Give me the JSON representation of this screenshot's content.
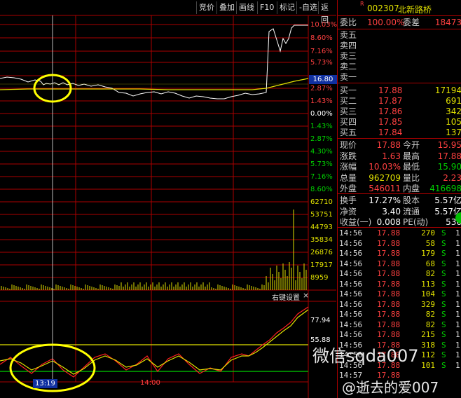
{
  "toolbar": {
    "buttons": [
      "竞价",
      "叠加",
      "画线",
      "F10",
      "标记",
      "-自选",
      "返回"
    ]
  },
  "price_axis": [
    "10.03%",
    "8.60%",
    "7.16%",
    "5.73%",
    "4.30%",
    "2.87%",
    "1.43%",
    "0.00%",
    "1.43%",
    "2.87%",
    "4.30%",
    "5.73%",
    "7.16%",
    "8.60%"
  ],
  "current_price_tag": "16.80",
  "volume_axis": [
    "62710",
    "53751",
    "44793",
    "35834",
    "26876",
    "17917",
    "8959"
  ],
  "indicator": {
    "header": "右键设置",
    "close": "×",
    "axis": [
      "77.94",
      "55.88"
    ]
  },
  "time_axis": {
    "cursor_time": "13:19",
    "label": "14:00"
  },
  "watermark": {
    "text": "微信sqda007",
    "footer": "@逝去的爱007"
  },
  "stock": {
    "flag": "R",
    "code": "002307",
    "name": "北新路桥"
  },
  "order_book": {
    "wei_bi_label": "委比",
    "wei_bi_value": "100.00%",
    "wei_cha_label": "委差",
    "wei_cha_value": "18473",
    "sells": [
      "卖五",
      "卖四",
      "卖三",
      "卖二",
      "卖一"
    ],
    "buys": [
      {
        "label": "买一",
        "price": "17.88",
        "vol": "17194"
      },
      {
        "label": "买二",
        "price": "17.87",
        "vol": "691"
      },
      {
        "label": "买三",
        "price": "17.86",
        "vol": "342"
      },
      {
        "label": "买四",
        "price": "17.85",
        "vol": "105"
      },
      {
        "label": "买五",
        "price": "17.84",
        "vol": "137"
      }
    ]
  },
  "quote": [
    {
      "l1": "现价",
      "v1": "17.88",
      "l2": "今开",
      "v2": "15.95"
    },
    {
      "l1": "涨跌",
      "v1": "1.63",
      "l2": "最高",
      "v2": "17.88"
    },
    {
      "l1": "涨幅",
      "v1": "10.03%",
      "l2": "最低",
      "v2": "15.90"
    },
    {
      "l1": "总量",
      "v1": "962709",
      "l2": "量比",
      "v2": "2.23"
    },
    {
      "l1": "外盘",
      "v1": "546011",
      "l2": "内盘",
      "v2": "416698"
    }
  ],
  "stats": [
    {
      "l1": "换手",
      "v1": "17.27%",
      "l2": "股本",
      "v2": "5.57亿"
    },
    {
      "l1": "净资",
      "v1": "3.40",
      "l2": "流通",
      "v2": "5.57亿"
    },
    {
      "l1": "收益(一)",
      "v1": "0.008",
      "l2": "PE(动)",
      "v2": "536"
    }
  ],
  "ticks": [
    {
      "time": "14:56",
      "price": "17.88",
      "vol": "270",
      "side": "S",
      "n": "1"
    },
    {
      "time": "14:56",
      "price": "17.88",
      "vol": "58",
      "side": "S",
      "n": "1"
    },
    {
      "time": "14:56",
      "price": "17.88",
      "vol": "179",
      "side": "S",
      "n": "1"
    },
    {
      "time": "14:56",
      "price": "17.88",
      "vol": "68",
      "side": "S",
      "n": "1"
    },
    {
      "time": "14:56",
      "price": "17.88",
      "vol": "82",
      "side": "S",
      "n": "1"
    },
    {
      "time": "14:56",
      "price": "17.88",
      "vol": "113",
      "side": "S",
      "n": "1"
    },
    {
      "time": "14:56",
      "price": "17.88",
      "vol": "104",
      "side": "S",
      "n": "1"
    },
    {
      "time": "14:56",
      "price": "17.88",
      "vol": "329",
      "side": "S",
      "n": "1"
    },
    {
      "time": "14:56",
      "price": "17.88",
      "vol": "82",
      "side": "S",
      "n": "1"
    },
    {
      "time": "14:56",
      "price": "17.88",
      "vol": "82",
      "side": "S",
      "n": "1"
    },
    {
      "time": "14:56",
      "price": "17.88",
      "vol": "215",
      "side": "S",
      "n": "1"
    },
    {
      "time": "14:56",
      "price": "17.88",
      "vol": "318",
      "side": "S",
      "n": "1"
    },
    {
      "time": "14:56",
      "price": "17.88",
      "vol": "112",
      "side": "S",
      "n": "1"
    },
    {
      "time": "14:56",
      "price": "17.88",
      "vol": "101",
      "side": "S",
      "n": "1"
    },
    {
      "time": "14:57",
      "price": "17.88",
      "vol": "",
      "side": "",
      "n": ""
    }
  ],
  "colors": {
    "grid_red": "#aa0000",
    "up_red": "#ff4040",
    "down_green": "#00d000",
    "price_line": "#ffffff",
    "avg_line": "#e0e000",
    "volume_bar": "#e0e000",
    "annotation": "#ffff00"
  }
}
